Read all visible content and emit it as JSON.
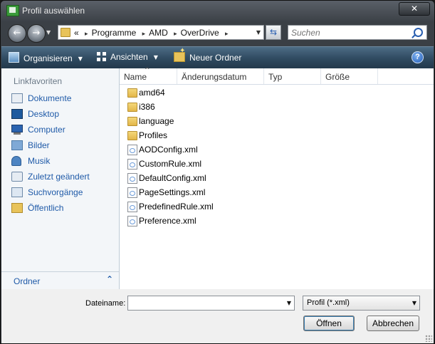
{
  "window": {
    "title": "Profil auswählen",
    "close_label": "✕"
  },
  "nav": {
    "back_icon": "←",
    "forward_icon": "→",
    "dropdown_icon": "▼",
    "address": {
      "overflow": "«",
      "crumbs": [
        "Programme",
        "AMD",
        "OverDrive"
      ],
      "separator": "▸",
      "dropdown_icon": "▼"
    },
    "refresh_icon": "⇆",
    "search_placeholder": "Suchen"
  },
  "toolbar": {
    "organize_label": "Organisieren",
    "views_label": "Ansichten",
    "new_folder_label": "Neuer Ordner",
    "caret": "▼",
    "help_label": "?"
  },
  "sidebar": {
    "heading": "Linkfavoriten",
    "items": [
      {
        "label": "Dokumente",
        "icon": "documents-icon"
      },
      {
        "label": "Desktop",
        "icon": "desktop-icon"
      },
      {
        "label": "Computer",
        "icon": "computer-icon"
      },
      {
        "label": "Bilder",
        "icon": "pictures-icon"
      },
      {
        "label": "Musik",
        "icon": "music-icon"
      },
      {
        "label": "Zuletzt geändert",
        "icon": "recent-icon"
      },
      {
        "label": "Suchvorgänge",
        "icon": "searches-icon"
      },
      {
        "label": "Öffentlich",
        "icon": "public-folder-icon"
      }
    ],
    "folders_label": "Ordner",
    "folders_chevron": "⌃"
  },
  "filelist": {
    "columns": [
      "Name",
      "Änderungsdatum",
      "Typ",
      "Größe"
    ],
    "sort_indicator": "^",
    "files": [
      {
        "name": "amd64",
        "kind": "folder"
      },
      {
        "name": "i386",
        "kind": "folder"
      },
      {
        "name": "language",
        "kind": "folder"
      },
      {
        "name": "Profiles",
        "kind": "folder"
      },
      {
        "name": "AODConfig.xml",
        "kind": "xml"
      },
      {
        "name": "CustomRule.xml",
        "kind": "xml"
      },
      {
        "name": "DefaultConfig.xml",
        "kind": "xml"
      },
      {
        "name": "PageSettings.xml",
        "kind": "xml"
      },
      {
        "name": "PredefinedRule.xml",
        "kind": "xml"
      },
      {
        "name": "Preference.xml",
        "kind": "xml"
      }
    ]
  },
  "footer": {
    "filename_label": "Dateiname:",
    "filename_value": "",
    "filetype_value": "Profil (*.xml)",
    "open_label": "Öffnen",
    "cancel_label": "Abbrechen",
    "combo_arrow": "▼"
  }
}
